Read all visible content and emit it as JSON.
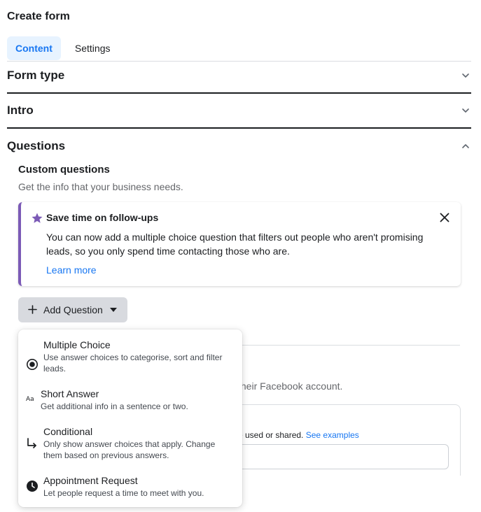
{
  "page": {
    "title": "Create form"
  },
  "tabs": [
    {
      "label": "Content",
      "active": true
    },
    {
      "label": "Settings",
      "active": false
    }
  ],
  "sections": {
    "form_type": "Form type",
    "intro": "Intro",
    "questions": "Questions"
  },
  "custom_questions": {
    "title": "Custom questions",
    "subtitle": "Get the info that your business needs."
  },
  "info_card": {
    "title": "Save time on follow-ups",
    "body": "You can now add a multiple choice question that filters out people who aren't promising leads, so you only spend time contacting those who are.",
    "link": "Learn more",
    "accent_color": "#7b5ab6"
  },
  "add_question": {
    "label": "Add Question"
  },
  "menu": {
    "items": [
      {
        "title": "Multiple Choice",
        "desc": "Use answer choices to categorise, sort and filter leads.",
        "icon": "radio-icon"
      },
      {
        "title": "Short Answer",
        "desc": "Get additional info in a sentence or two.",
        "icon": "text-aa-icon"
      },
      {
        "title": "Conditional",
        "desc": "Only show answer choices that apply. Change them based on previous answers.",
        "icon": "branch-arrow-icon"
      },
      {
        "title": "Appointment Request",
        "desc": "Let people request a time to meet with you.",
        "icon": "clock-icon"
      }
    ]
  },
  "background": {
    "partial_text1": "their Facebook account.",
    "partial_text2": "e used or shared.",
    "partial_link": "See examples"
  },
  "colors": {
    "link": "#1877f2",
    "tab_active_bg": "#e7f3ff"
  }
}
